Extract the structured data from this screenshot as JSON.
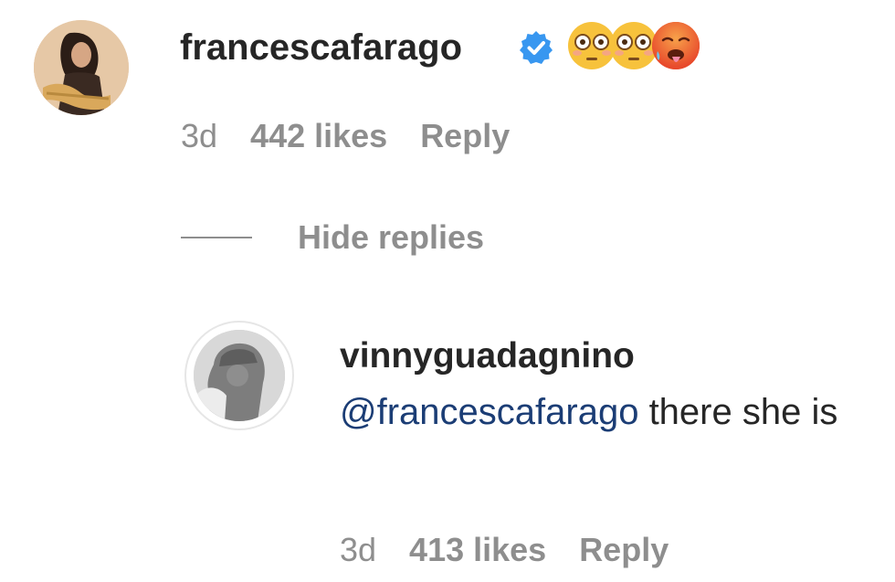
{
  "comment": {
    "username": "francescafarago",
    "verified_icon": "verified-badge-icon",
    "emojis": [
      "flushed-face-icon",
      "flushed-face-icon",
      "hot-face-icon"
    ],
    "time": "3d",
    "likes": "442 likes",
    "reply_label": "Reply",
    "avatar_icon": "profile-photo"
  },
  "hide_replies": {
    "label": "Hide replies"
  },
  "reply": {
    "username": "vinnyguadagnino",
    "mention": "@francescafarago",
    "text": " there she is",
    "time": "3d",
    "likes": "413 likes",
    "reply_label": "Reply",
    "avatar_icon": "profile-photo"
  },
  "colors": {
    "text_primary": "#262626",
    "text_secondary": "#8e8e8e",
    "mention": "#1b3d75",
    "verified": "#3897f0"
  }
}
